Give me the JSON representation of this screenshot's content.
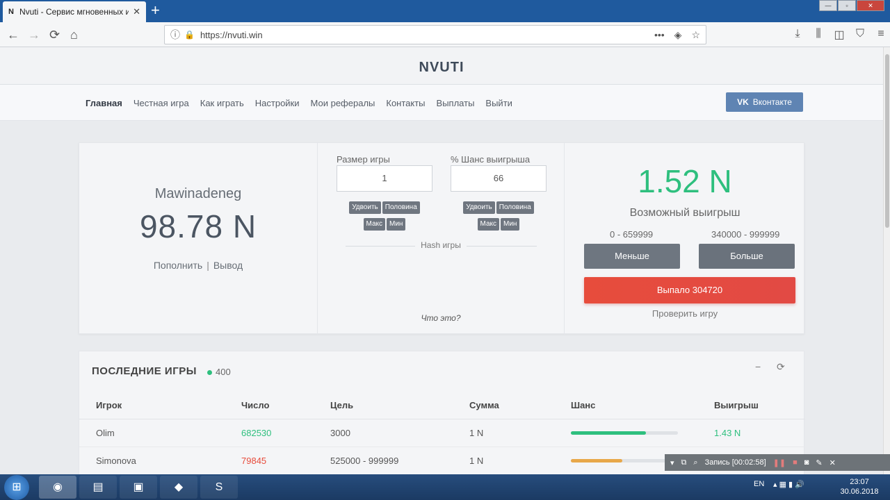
{
  "browser": {
    "favicon": "N",
    "tab_title": "Nvuti - Сервис мгновенных иг",
    "tab_close": "✕",
    "new_tab": "+",
    "url": "https://nvuti.win",
    "window_controls": [
      "—",
      "▫",
      "✕"
    ]
  },
  "site": {
    "brand": "NVUTI",
    "menu": [
      "Главная",
      "Честная игра",
      "Как играть",
      "Настройки",
      "Мои рефералы",
      "Контакты",
      "Выплаты",
      "Выйти"
    ],
    "vk_button": "Вконтакте",
    "vk_logo": "VK"
  },
  "account": {
    "username": "Mawinadeneg",
    "balance": "98.78 N",
    "deposit": "Пополнить",
    "separator": "|",
    "withdraw": "Вывод"
  },
  "bet": {
    "size_label": "Размер игры",
    "size_value": "1",
    "chance_label": "% Шанс выигрыша",
    "chance_value": "66",
    "btn_double": "Удвоить",
    "btn_half": "Половина",
    "btn_max": "Макс",
    "btn_min": "Мин",
    "hash_label": "Hash игры",
    "what_is": "Что это?"
  },
  "result": {
    "payout": "1.52 N",
    "payout_label": "Возможный выигрыш",
    "range_low": "0 - 659999",
    "range_high": "340000 - 999999",
    "btn_less": "Меньше",
    "btn_more": "Больше",
    "rolled": "Выпало 304720",
    "verify": "Проверить игру",
    "colors": {
      "payout": "#2ebf7e",
      "rolled_bg": "#e74c3c"
    }
  },
  "games": {
    "title": "ПОСЛЕДНИЕ ИГРЫ",
    "online_count": "400",
    "minimize": "−",
    "refresh": "⟳",
    "headers": [
      "Игрок",
      "Число",
      "Цель",
      "Сумма",
      "Шанс",
      "Выигрыш"
    ],
    "rows": [
      {
        "player": "Olim",
        "number": "682530",
        "target": "3000",
        "amount": "1 N",
        "chance_pct": 70,
        "win": "1.43 N",
        "status": "win"
      },
      {
        "player": "Simonova",
        "number": "79845",
        "target": "525000 - 999999",
        "amount": "1 N",
        "chance_pct": 48,
        "win": "",
        "status": "loss"
      }
    ]
  },
  "recorder": {
    "label": "Запись [00:02:58]"
  },
  "taskbar": {
    "lang": "EN",
    "time": "23:07",
    "date": "30.06.2018"
  }
}
